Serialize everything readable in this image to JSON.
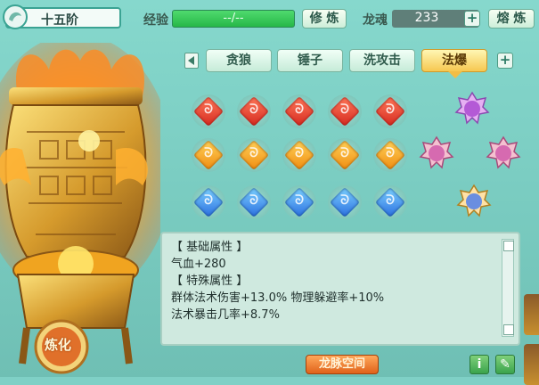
{
  "header": {
    "rank_label": "十五阶",
    "exp_label": "经验",
    "exp_value": "--/--",
    "cultivate_button": "修 炼",
    "soul_label": "龙魂",
    "soul_value": "233",
    "smelt_button": "熔 炼"
  },
  "tabs": [
    {
      "label": "贪狼",
      "active": false
    },
    {
      "label": "锤子",
      "active": false
    },
    {
      "label": "洗攻击",
      "active": false
    },
    {
      "label": "法爆",
      "active": true
    }
  ],
  "gems": {
    "row1_color": "red",
    "row2_color": "orange",
    "row3_color": "blue",
    "per_row": 5,
    "glyph": "ᘐ"
  },
  "attributes": {
    "base_header": "【 基础属性 】",
    "base_line": "气血+280",
    "special_header": "【 特殊属性 】",
    "special_line1": "群体法术伤害+13.0%  物理躲避率+10%",
    "special_line2": "法术暴击几率+8.7%"
  },
  "buttons": {
    "refine": "炼化",
    "dragon_space": "龙脉空间",
    "info": "i",
    "note": "✎"
  },
  "colors": {
    "accent_green": "#27b748",
    "tab_active": "#f6c750",
    "space_button": "#e0621a"
  }
}
